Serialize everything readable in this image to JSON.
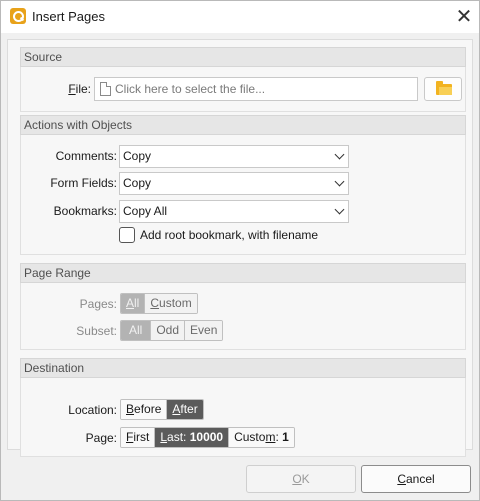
{
  "window": {
    "title": "Insert Pages",
    "close_glyph": "✕"
  },
  "source": {
    "header": "Source",
    "file_label": "File:",
    "file_placeholder": "Click here to select the file...",
    "browse_icon": "folder-open-icon"
  },
  "actions": {
    "header": "Actions with Objects",
    "comments_label": "Comments:",
    "comments_value": "Copy",
    "form_fields_label": "Form Fields:",
    "form_fields_value": "Copy",
    "bookmarks_label": "Bookmarks:",
    "bookmarks_value": "Copy All",
    "root_bookmark_label": "Add root bookmark, with filename",
    "root_bookmark_checked": false
  },
  "page_range": {
    "header": "Page Range",
    "pages_label": "Pages:",
    "pages_options": [
      "All",
      "Custom"
    ],
    "pages_selected": "All",
    "subset_label": "Subset:",
    "subset_options": [
      "All",
      "Odd",
      "Even"
    ],
    "subset_selected": "All"
  },
  "destination": {
    "header": "Destination",
    "location_label": "Location:",
    "location_options": [
      "Before",
      "After"
    ],
    "location_selected": "After",
    "page_label": "Page:",
    "page_first": "First",
    "page_last_label": "Last:",
    "page_last_value": "10000",
    "page_custom_label": "Custom:",
    "page_custom_value": "1"
  },
  "footer": {
    "ok_label": "OK",
    "cancel_label": "Cancel"
  },
  "colors": {
    "selected_segment": "#5b5b5b",
    "disabled_selected": "#b3b3b3",
    "app_icon": "#e8a21a"
  }
}
